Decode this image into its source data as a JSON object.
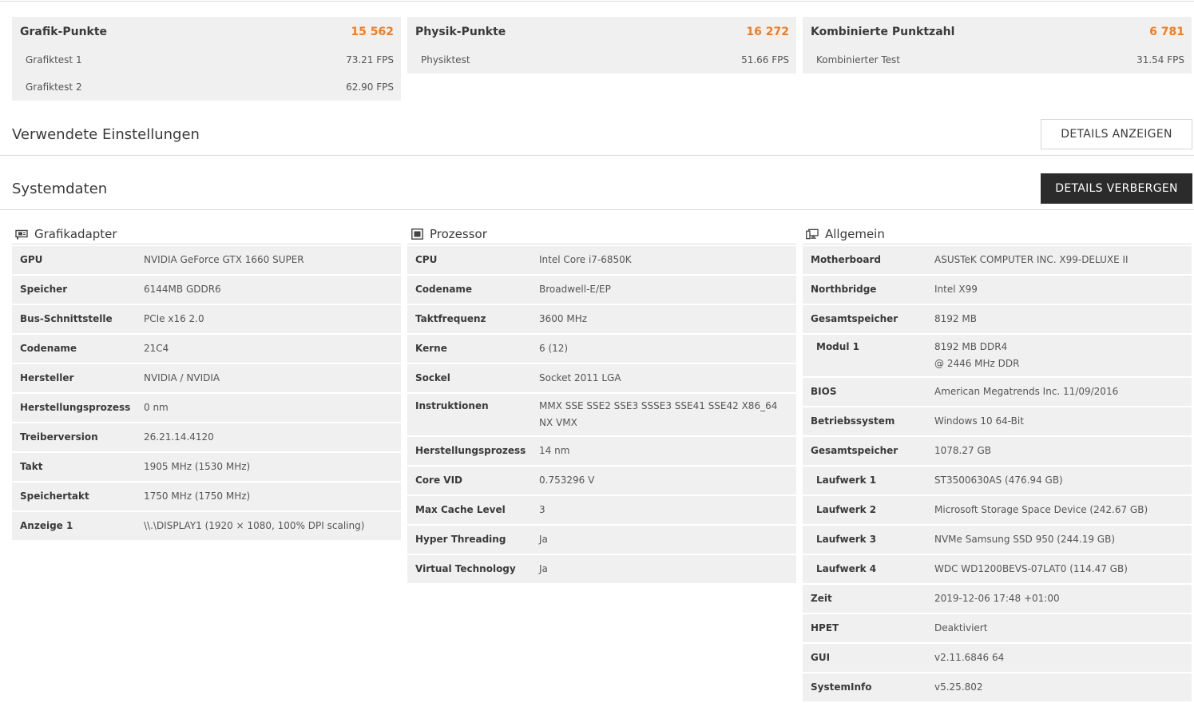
{
  "scores": [
    {
      "title": "Grafik-Punkte",
      "value": "15 562",
      "tests": [
        {
          "name": "Grafiktest 1",
          "value": "73.21 FPS"
        },
        {
          "name": "Grafiktest 2",
          "value": "62.90 FPS"
        }
      ]
    },
    {
      "title": "Physik-Punkte",
      "value": "16 272",
      "tests": [
        {
          "name": "Physiktest",
          "value": "51.66 FPS"
        }
      ]
    },
    {
      "title": "Kombinierte Punktzahl",
      "value": "6 781",
      "tests": [
        {
          "name": "Kombinierter Test",
          "value": "31.54 FPS"
        }
      ]
    }
  ],
  "settings": {
    "title": "Verwendete Einstellungen",
    "button": "DETAILS ANZEIGEN"
  },
  "system": {
    "title": "Systemdaten",
    "button": "DETAILS VERBERGEN"
  },
  "columns": [
    {
      "title": "Grafikadapter",
      "icon": "gpu-icon",
      "rows": [
        {
          "k": "GPU",
          "v": "NVIDIA GeForce GTX 1660 SUPER"
        },
        {
          "k": "Speicher",
          "v": "6144MB GDDR6"
        },
        {
          "k": "Bus-Schnittstelle",
          "v": "PCIe x16 2.0"
        },
        {
          "k": "Codename",
          "v": "21C4"
        },
        {
          "k": "Hersteller",
          "v": "NVIDIA / NVIDIA"
        },
        {
          "k": "Herstellungsprozess",
          "v": "0 nm"
        },
        {
          "k": "Treiberversion",
          "v": "26.21.14.4120"
        },
        {
          "k": "Takt",
          "v": "1905 MHz (1530 MHz)"
        },
        {
          "k": "Speichertakt",
          "v": "1750 MHz (1750 MHz)"
        },
        {
          "k": "Anzeige 1",
          "v": "\\\\.\\DISPLAY1 (1920 × 1080, 100% DPI scaling)"
        }
      ]
    },
    {
      "title": "Prozessor",
      "icon": "cpu-icon",
      "rows": [
        {
          "k": "CPU",
          "v": "Intel Core i7-6850K"
        },
        {
          "k": "Codename",
          "v": "Broadwell-E/EP"
        },
        {
          "k": "Taktfrequenz",
          "v": "3600 MHz"
        },
        {
          "k": "Kerne",
          "v": "6 (12)"
        },
        {
          "k": "Sockel",
          "v": "Socket 2011 LGA"
        },
        {
          "k": "Instruktionen",
          "v": "MMX SSE SSE2 SSE3 SSSE3 SSE41 SSE42 X86_64 NX VMX"
        },
        {
          "k": "Herstellungsprozess",
          "v": "14 nm"
        },
        {
          "k": "Core VID",
          "v": "0.753296 V"
        },
        {
          "k": "Max Cache Level",
          "v": "3"
        },
        {
          "k": "Hyper Threading",
          "v": "Ja"
        },
        {
          "k": "Virtual Technology",
          "v": "Ja"
        }
      ]
    },
    {
      "title": "Allgemein",
      "icon": "computer-icon",
      "rows": [
        {
          "k": "Motherboard",
          "v": "ASUSTeK COMPUTER INC. X99-DELUXE II"
        },
        {
          "k": "Northbridge",
          "v": "Intel X99"
        },
        {
          "k": "Gesamtspeicher",
          "v": "8192 MB"
        },
        {
          "k": "Modul 1",
          "v": "8192 MB DDR4",
          "v2": "@ 2446 MHz DDR",
          "sub": true
        },
        {
          "k": "BIOS",
          "v": "American Megatrends Inc. 11/09/2016"
        },
        {
          "k": "Betriebssystem",
          "v": "Windows 10 64-Bit"
        },
        {
          "k": "Gesamtspeicher",
          "v": "1078.27 GB"
        },
        {
          "k": "Laufwerk 1",
          "v": "ST3500630AS (476.94 GB)",
          "sub": true
        },
        {
          "k": "Laufwerk 2",
          "v": "Microsoft Storage Space Device (242.67 GB)",
          "sub": true
        },
        {
          "k": "Laufwerk 3",
          "v": "NVMe Samsung SSD 950 (244.19 GB)",
          "sub": true
        },
        {
          "k": "Laufwerk 4",
          "v": "WDC WD1200BEVS-07LAT0 (114.47 GB)",
          "sub": true
        },
        {
          "k": "Zeit",
          "v": "2019-12-06 17:48 +01:00"
        },
        {
          "k": "HPET",
          "v": "Deaktiviert"
        },
        {
          "k": "GUI",
          "v": "v2.11.6846 64"
        },
        {
          "k": "SystemInfo",
          "v": "v5.25.802"
        }
      ]
    }
  ]
}
